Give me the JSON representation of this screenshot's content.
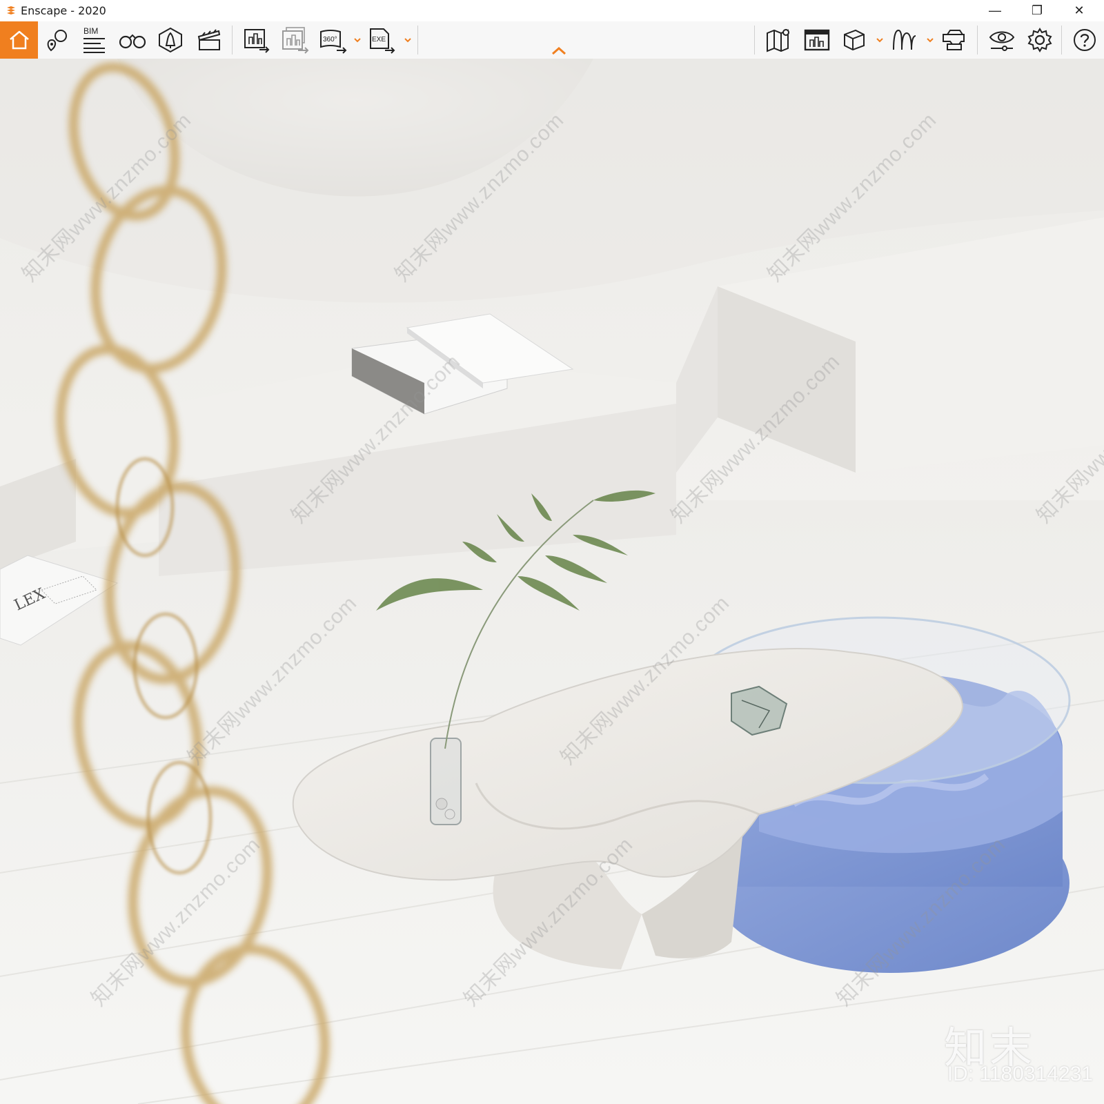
{
  "window": {
    "title": "Enscape - 2020",
    "controls": {
      "minimize": "—",
      "restore": "❐",
      "close": "✕"
    }
  },
  "toolbar": {
    "accent_color": "#f07f1f",
    "bim_label": "BIM",
    "panorama_label": "360°",
    "exe_label": "EXE",
    "left_icons": [
      "home-icon",
      "views-icon",
      "bim-info-icon",
      "binoculars-icon",
      "asset-library-icon",
      "video-editor-icon",
      "screenshot-export-icon",
      "batch-render-icon",
      "panorama-export-icon",
      "exe-export-icon"
    ],
    "right_icons": [
      "map-icon",
      "material-editor-icon",
      "cube-icon",
      "atmosphere-icon",
      "vr-headset-icon",
      "visual-settings-icon",
      "settings-icon",
      "help-icon"
    ]
  },
  "watermark": {
    "text": "知末网www.znzmo.com",
    "brand": "知末",
    "id": "ID: 1180314231"
  },
  "scene": {
    "books_left_text": "LEX"
  }
}
